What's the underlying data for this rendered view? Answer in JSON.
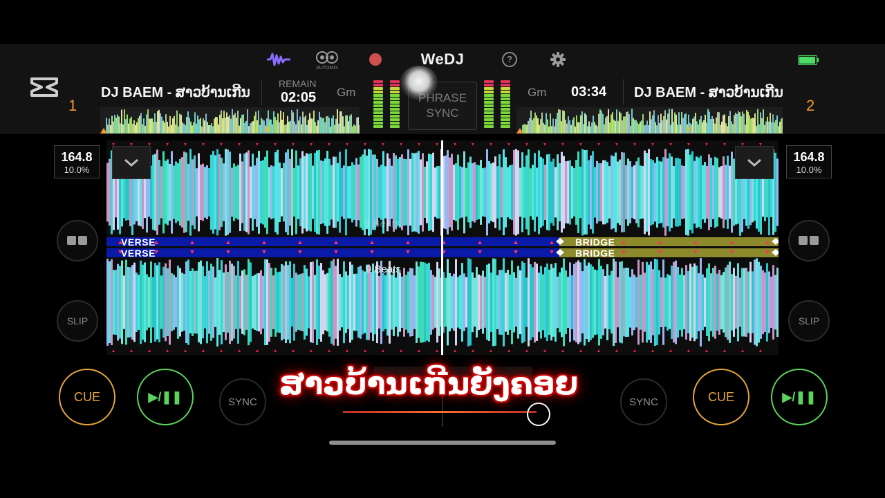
{
  "app": {
    "name": "WeDJ"
  },
  "status": {
    "battery_color": "#4cd964"
  },
  "toolbar": {
    "waveform_icon": "waveform-icon",
    "automix_label": "AUTOMIX",
    "record_icon": "record-icon",
    "help_label": "?",
    "settings_icon": "gear-icon"
  },
  "deck1": {
    "number": "1",
    "title": "DJ BAEM - ສາວບ້ານເກີນ",
    "remain_label": "REMAIN",
    "remain_time": "02:05",
    "key": "Gm",
    "bpm": "164.8",
    "pitch": "10.0%",
    "cue_label": "CUE",
    "play_label": "▶/❚❚",
    "sync_label": "SYNC",
    "slip_label": "SLIP"
  },
  "deck2": {
    "number": "2",
    "key": "Gm",
    "time": "03:34",
    "title": "DJ BAEM - ສາວບ້ານເກີນ",
    "bpm": "164.8",
    "pitch": "10.0%",
    "cue_label": "CUE",
    "play_label": "▶/❚❚",
    "sync_label": "SYNC",
    "slip_label": "SLIP"
  },
  "phrase_sync": {
    "line1": "PHRASE",
    "line2": "SYNC"
  },
  "waveform": {
    "top_beats_label": "9 Beats",
    "bottom_beats_label": "9 Beats",
    "section_verse_top": "VERSE",
    "section_verse_bottom": "VERSE",
    "section_bridge_top": "BRIDGE",
    "section_bridge_bottom": "BRIDGE"
  },
  "colors": {
    "cue": "#e6a43a",
    "play": "#5cd35c",
    "deck_number": "#f39a2a",
    "verse_band": "#0a1aa8",
    "bridge_band": "#8c8a2a",
    "wave_main": "#3fe0e0"
  },
  "overlay": {
    "subtitle": "ສາວບ້ານເກີນຍັງຄອຍ"
  }
}
